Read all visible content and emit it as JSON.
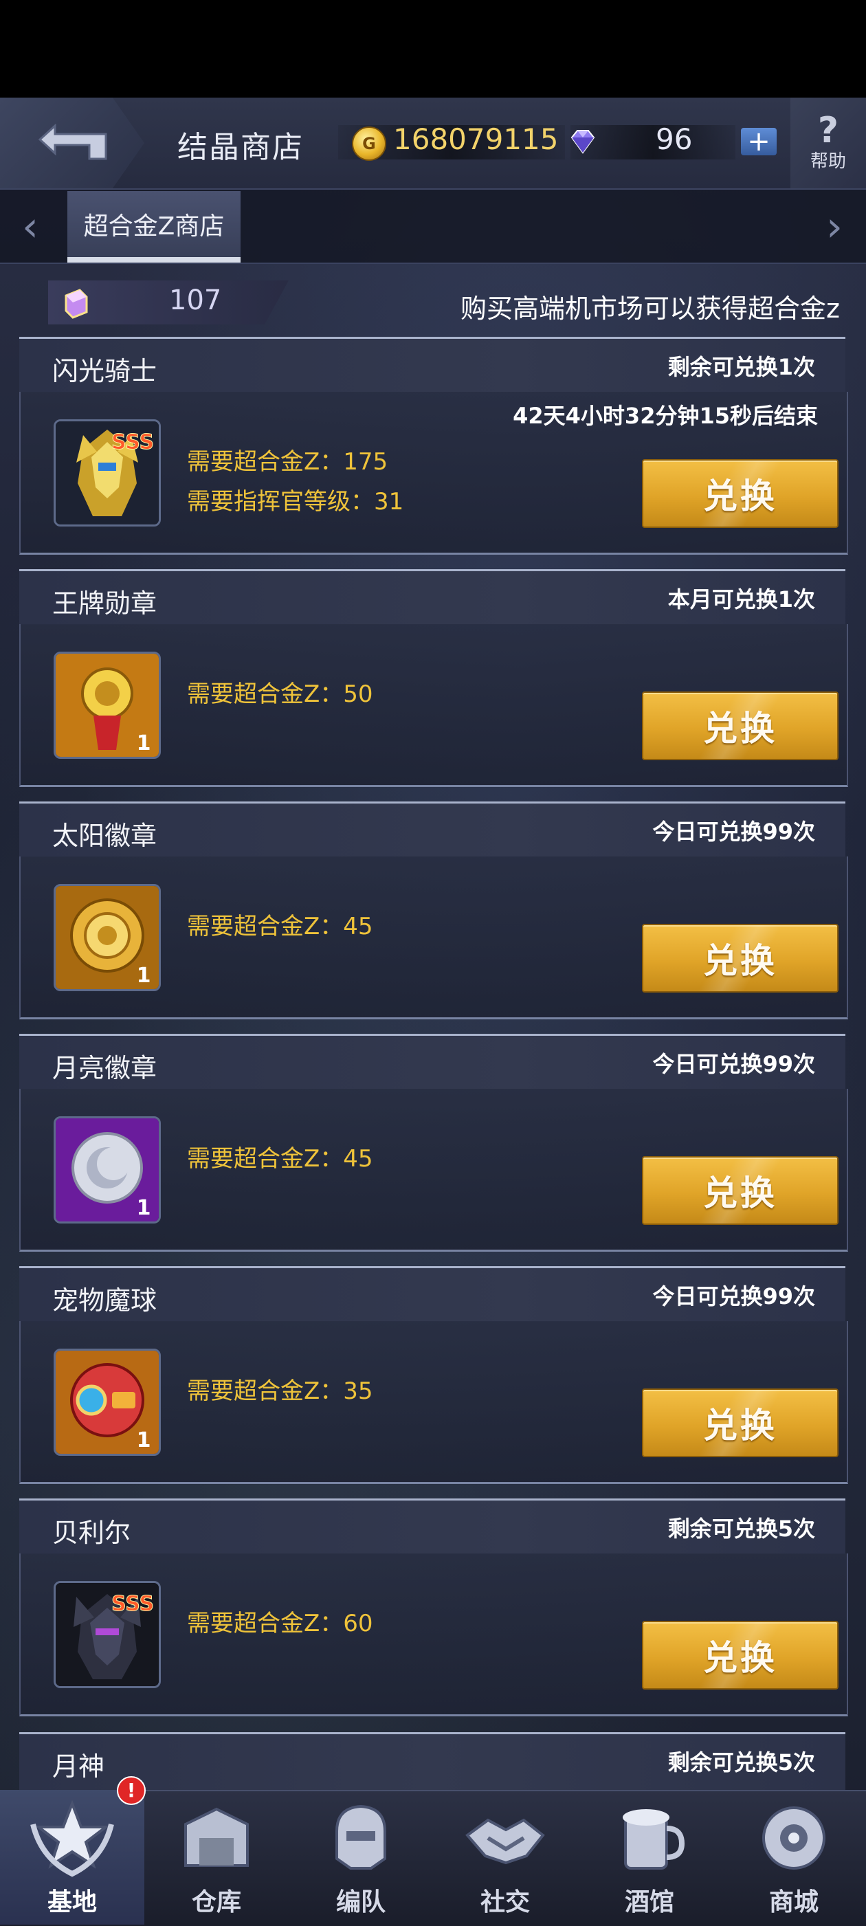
{
  "header": {
    "title": "结晶商店",
    "gold": "168079115",
    "gems": "96",
    "plus": "+",
    "help_icon": "?",
    "help_label": "帮助"
  },
  "tabs": {
    "active": "超合金Z商店"
  },
  "info": {
    "z_amount": "107",
    "hint": "购买高端机市场可以获得超合金z"
  },
  "items": [
    {
      "name": "闪光骑士",
      "limit": "剩余可兑换1次",
      "timer": "42天4小时32分钟15秒后结束",
      "req1": "需要超合金Z：175",
      "req2": "需要指挥官等级：31",
      "badge": "SSS",
      "button": "兑换"
    },
    {
      "name": "王牌勋章",
      "limit": "本月可兑换1次",
      "req1": "需要超合金Z：50",
      "count": "1",
      "button": "兑换"
    },
    {
      "name": "太阳徽章",
      "limit": "今日可兑换99次",
      "req1": "需要超合金Z：45",
      "count": "1",
      "button": "兑换"
    },
    {
      "name": "月亮徽章",
      "limit": "今日可兑换99次",
      "req1": "需要超合金Z：45",
      "count": "1",
      "button": "兑换"
    },
    {
      "name": "宠物魔球",
      "limit": "今日可兑换99次",
      "req1": "需要超合金Z：35",
      "count": "1",
      "button": "兑换"
    },
    {
      "name": "贝利尔",
      "limit": "剩余可兑换5次",
      "req1": "需要超合金Z：60",
      "badge": "SSS",
      "button": "兑换"
    },
    {
      "name": "月神",
      "limit": "剩余可兑换5次"
    }
  ],
  "nav": [
    {
      "label": "基地",
      "icon": "base-star-icon",
      "badge": "!"
    },
    {
      "label": "仓库",
      "icon": "warehouse-icon"
    },
    {
      "label": "编队",
      "icon": "formation-helmet-icon"
    },
    {
      "label": "社交",
      "icon": "handshake-icon"
    },
    {
      "label": "酒馆",
      "icon": "tavern-icon"
    },
    {
      "label": "商城",
      "icon": "mall-icon"
    }
  ],
  "colors": {
    "accent_gold": "#efc33a",
    "button_gold": "#e0a428",
    "badge_red": "#e02626"
  }
}
